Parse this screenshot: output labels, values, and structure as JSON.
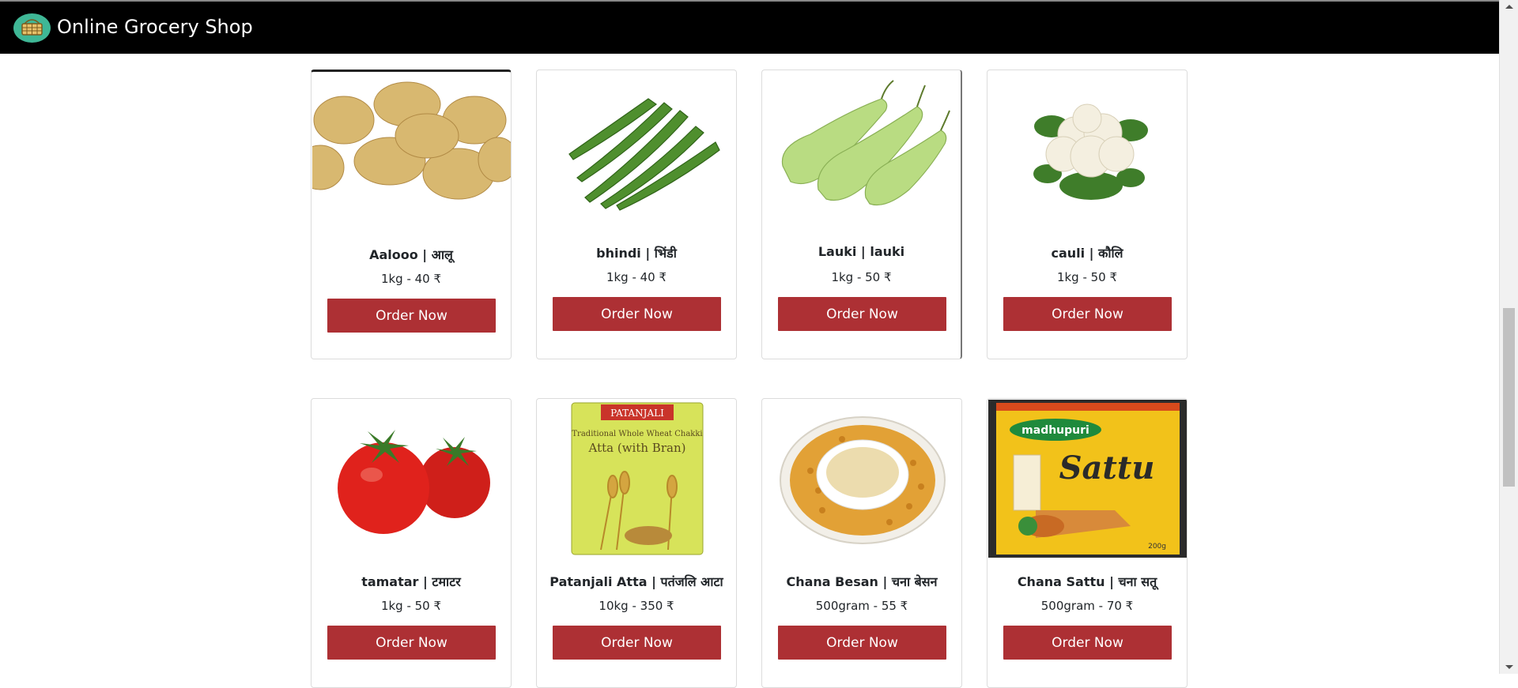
{
  "header": {
    "brand_name": "Online Grocery Shop",
    "logo_icon": "basket-icon",
    "background_color": "#000000"
  },
  "accent_color": "#ad3034",
  "products": [
    {
      "title": "Aalooo | आलू",
      "price": "1kg - 40 ₹",
      "button_label": "Order Now",
      "image": "potatoes-image"
    },
    {
      "title": "bhindi | भिंडी",
      "price": "1kg - 40 ₹",
      "button_label": "Order Now",
      "image": "okra-image"
    },
    {
      "title": "Lauki | lauki",
      "price": "1kg - 50 ₹",
      "button_label": "Order Now",
      "image": "bottle-gourd-image"
    },
    {
      "title": "cauli | कौलि",
      "price": "1kg - 50 ₹",
      "button_label": "Order Now",
      "image": "cauliflower-image"
    },
    {
      "title": "tamatar | टमाटर",
      "price": "1kg - 50 ₹",
      "button_label": "Order Now",
      "image": "tomatoes-image"
    },
    {
      "title": "Patanjali Atta | पतंजलि आटा",
      "price": "10kg - 350 ₹",
      "button_label": "Order Now",
      "image": "atta-pack-image"
    },
    {
      "title": "Chana Besan | चना बेसन",
      "price": "500gram - 55 ₹",
      "button_label": "Order Now",
      "image": "besan-plate-image"
    },
    {
      "title": "Chana Sattu | चना सतू",
      "price": "500gram - 70 ₹",
      "button_label": "Order Now",
      "image": "sattu-pack-image"
    }
  ],
  "image_labels": {
    "patanjali_brand": "PATANJALI",
    "atta_pack_line1": "Traditional Whole Wheat Chakki",
    "atta_pack_line2": "Atta (with Bran)",
    "sattu_brand": "madhupuri",
    "sattu_name": "Sattu",
    "sattu_weight": "200g"
  }
}
